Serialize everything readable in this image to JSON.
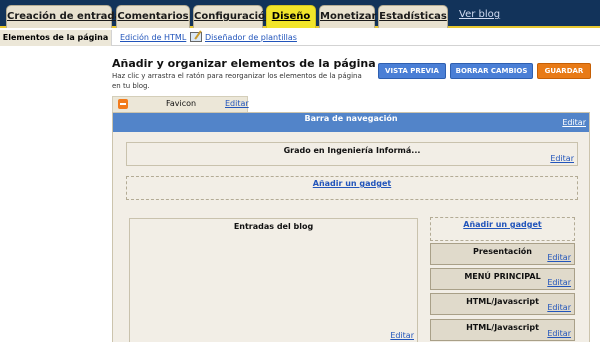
{
  "topnav": {
    "tabs": [
      {
        "label": "Creación de entradas"
      },
      {
        "label": "Comentarios"
      },
      {
        "label": "Configuración"
      },
      {
        "label": "Diseño"
      },
      {
        "label": "Monetizar"
      },
      {
        "label": "Estadísticas"
      }
    ],
    "view_blog": "Ver blog"
  },
  "subnav": {
    "items": [
      {
        "label": "Elementos de la página"
      },
      {
        "label": "Edición de HTML"
      },
      {
        "label": "Diseñador de plantillas"
      }
    ]
  },
  "header": {
    "title": "Añadir y organizar elementos de la página",
    "help": "Haz clic y arrastra el ratón para reorganizar los elementos de la página en tu blog."
  },
  "buttons": {
    "preview": "VISTA PREVIA",
    "clear": "BORRAR CAMBIOS",
    "save": "GUARDAR"
  },
  "favicon": {
    "label": "Favicon",
    "edit": "Editar"
  },
  "layout": {
    "navbar": {
      "title": "Barra de navegación",
      "edit": "Editar"
    },
    "header_widget": {
      "title": "Grado en Ingeniería Informá...",
      "edit": "Editar"
    },
    "add_gadget": "Añadir un gadget",
    "posts": {
      "title": "Entradas del blog",
      "edit": "Editar"
    },
    "sidebar": {
      "add_gadget": "Añadir un gadget",
      "items": [
        {
          "title": "Presentación",
          "edit": "Editar"
        },
        {
          "title": "MENÚ PRINCIPAL",
          "edit": "Editar"
        },
        {
          "title": "HTML/Javascript",
          "edit": "Editar"
        },
        {
          "title": "HTML/Javascript",
          "edit": "Editar"
        }
      ]
    }
  },
  "colors": {
    "nav_bg": "#12335a",
    "active_tab": "#f2e52a",
    "navbar_blue": "#5284c9",
    "button_blue": "#4a7fd6",
    "button_orange": "#e87a16",
    "link": "#2255bb"
  },
  "icons": {
    "favicon": "blogger-icon",
    "template_designer": "pencil-icon"
  }
}
